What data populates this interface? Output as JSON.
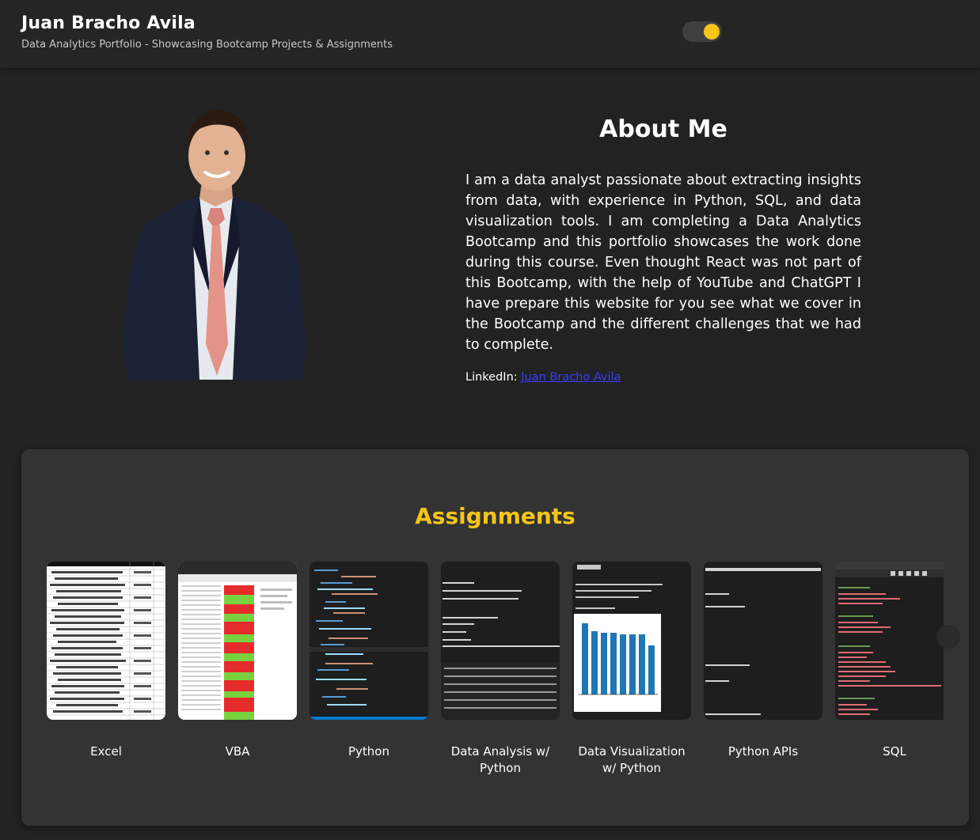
{
  "header": {
    "title": "Juan Bracho Avila",
    "subtitle": "Data Analytics Portfolio - Showcasing Bootcamp Projects & Assignments"
  },
  "about": {
    "title": "About Me",
    "text": "I am a data analyst passionate about extracting insights from data, with experience in Python, SQL, and data visualization tools. I am completing a Data Analytics Bootcamp and this portfolio showcases the work done during this course. Even thought React was not part of this Bootcamp, with the help of YouTube and ChatGPT I have prepare this website for you see what we cover in the Bootcamp and the different challenges that we had to complete.",
    "linkedin_label": "LinkedIn:",
    "linkedin_link": "Juan Bracho Avila"
  },
  "assignments": {
    "title": "Assignments",
    "cards": [
      {
        "label": "Excel"
      },
      {
        "label": "VBA"
      },
      {
        "label": "Python"
      },
      {
        "label": "Data Analysis w/ Python"
      },
      {
        "label": "Data Visualization w/ Python"
      },
      {
        "label": "Python APIs"
      },
      {
        "label": "SQL"
      }
    ]
  },
  "colors": {
    "accent": "#f5c518",
    "background": "#222222",
    "panel": "#333333",
    "link": "#3b3bff"
  }
}
